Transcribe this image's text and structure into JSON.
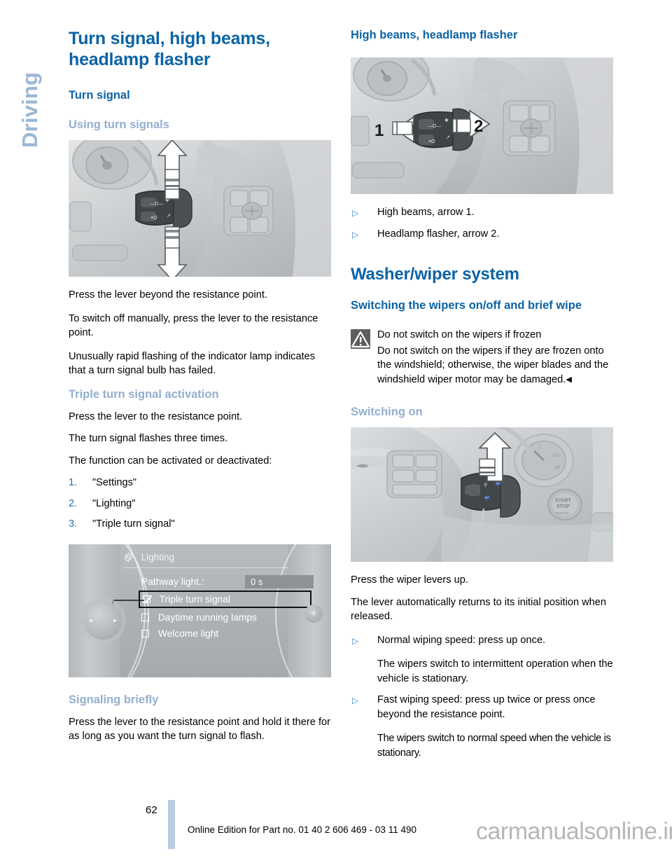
{
  "chapter_tab": {
    "label": "Driving"
  },
  "left_column": {
    "title": "Turn signal, high beams, headlamp flasher",
    "section_heading": "Turn signal",
    "subheading_1": "Using turn signals",
    "figure_1": {
      "name": "turn-signal-stalk-photo",
      "alt": "Steering column turn signal lever with up and down arrows"
    },
    "paragraphs_1": [
      "Press the lever beyond the resistance point.",
      "To switch off manually, press the lever to the resistance point.",
      "Unusually rapid flashing of the indicator lamp indicates that a turn signal bulb has failed."
    ],
    "subheading_2": "Triple turn signal activation",
    "paragraphs_2": [
      "Press the lever to the resistance point.",
      "The turn signal flashes three times.",
      "The function can be activated or deactivated:"
    ],
    "steps": [
      {
        "num": "1.",
        "label": "\"Settings\""
      },
      {
        "num": "2.",
        "label": "\"Lighting\""
      },
      {
        "num": "3.",
        "label": "\"Triple turn signal\""
      }
    ],
    "idrive": {
      "name": "idrive-lighting-menu",
      "title": "Lighting",
      "gear_icon": "gear-icon",
      "rows": [
        {
          "label": "Pathway light.:",
          "value": "0 s",
          "checkbox": false,
          "checked": false,
          "selected": false
        },
        {
          "label": "Triple turn signal",
          "value": "",
          "checkbox": true,
          "checked": true,
          "selected": true
        },
        {
          "label": "Daytime running lamps",
          "value": "",
          "checkbox": true,
          "checked": false,
          "selected": false
        },
        {
          "label": "Welcome light",
          "value": "",
          "checkbox": true,
          "checked": false,
          "selected": false
        }
      ],
      "controller_left_arrow": "◂",
      "controller_right_arrow": "▸",
      "plus_label": "+"
    },
    "subheading_3": "Signaling briefly",
    "paragraphs_3": [
      "Press the lever to the resistance point and hold it there for as long as you want the turn signal to flash."
    ]
  },
  "right_column": {
    "subheading_1": "High beams, headlamp flasher",
    "figure_1": {
      "name": "high-beam-stalk-photo",
      "alt": "Steering column lever with arrow 1 pointing left and arrow 2 pointing right"
    },
    "figure_1_arrow_labels": [
      "1",
      "2"
    ],
    "bullets_1": [
      "High beams, arrow 1.",
      "Headlamp flasher, arrow 2."
    ],
    "title": "Washer/wiper system",
    "subheading_2": "Switching the wipers on/off and brief wipe",
    "warning": {
      "icon": "warning-triangle-icon",
      "heading": "Do not switch on the wipers if frozen",
      "body": "Do not switch on the wipers if they are frozen onto the windshield; otherwise, the wiper blades and the windshield wiper motor may be damaged.",
      "end_mark": "◀"
    },
    "subheading_3": "Switching on",
    "figure_2": {
      "name": "wiper-stalk-photo",
      "alt": "Wiper lever with up arrow, START STOP button visible"
    },
    "paragraphs_1": [
      "Press the wiper levers up.",
      "The lever automatically returns to its initial position when released."
    ],
    "bullets_2": [
      {
        "text": "Normal wiping speed: press up once.",
        "note": "The wipers switch to intermittent operation when the vehicle is stationary."
      },
      {
        "text": "Fast wiping speed: press up twice or press once beyond the resistance point.",
        "note": "The wipers switch to normal speed when the vehicle is stationary."
      }
    ]
  },
  "footer": {
    "page_number": "62",
    "edition_text": "Online Edition for Part no. 01 40 2 606 469 - 03 11 490"
  },
  "watermark": {
    "text": "carmanualsonline.info"
  },
  "colors": {
    "heading_dark_blue": "#0b63a5",
    "heading_light_blue": "#92afd0",
    "tab_blue": "#9bb7d4",
    "list_number_blue": "#1f72b8",
    "bullet_blue": "#3a84c4",
    "footer_rule": "#b8cbe2",
    "warning_icon_bg": "#5d5d5d"
  }
}
